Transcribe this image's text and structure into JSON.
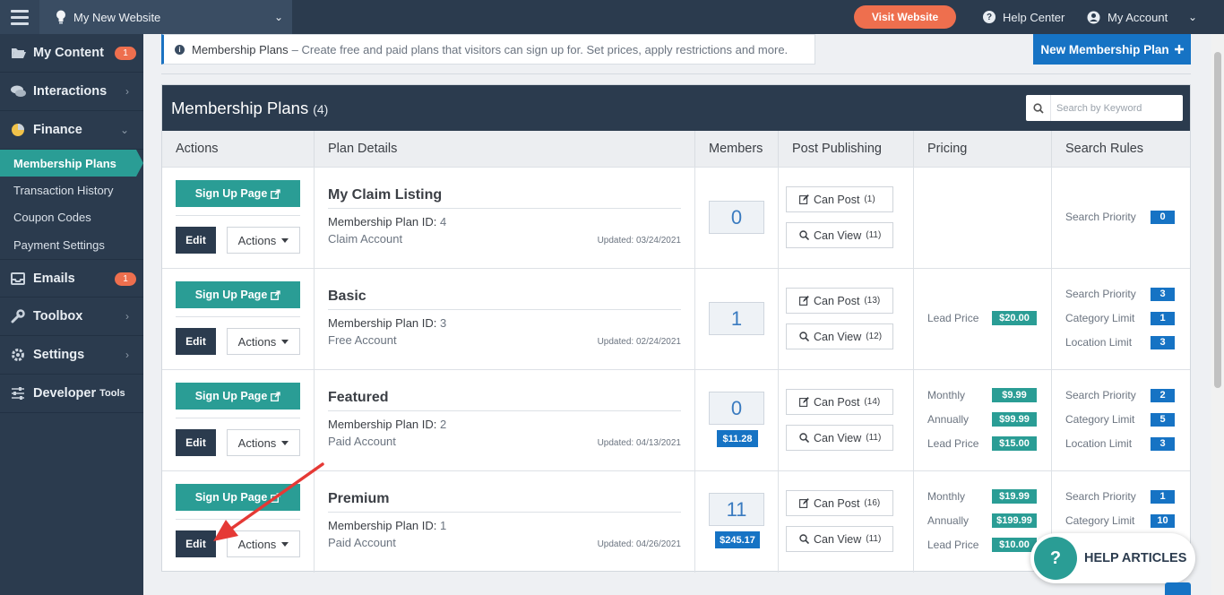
{
  "topbar": {
    "site_name": "My New Website",
    "visit_label": "Visit Website",
    "help_center_label": "Help Center",
    "my_account_label": "My Account"
  },
  "sidebar": {
    "items": [
      {
        "label": "My Content",
        "badge": "1"
      },
      {
        "label": "Interactions"
      },
      {
        "label": "Finance"
      },
      {
        "label": "Emails",
        "badge": "1"
      },
      {
        "label": "Toolbox"
      },
      {
        "label": "Settings"
      },
      {
        "label": "Developer",
        "suffix": "Tools"
      }
    ],
    "finance_sub": [
      "Membership Plans",
      "Transaction History",
      "Coupon Codes",
      "Payment Settings"
    ]
  },
  "info": {
    "title": "Membership Plans",
    "text": "– Create free and paid plans that visitors can sign up for. Set prices, apply restrictions and more."
  },
  "new_plan_label": "New Membership Plan",
  "panel": {
    "title": "Membership Plans",
    "count": "(4)",
    "search_placeholder": "Search by Keyword"
  },
  "columns": [
    "Actions",
    "Plan Details",
    "Members",
    "Post Publishing",
    "Pricing",
    "Search Rules"
  ],
  "buttons": {
    "signup": "Sign Up Page",
    "edit": "Edit",
    "actions": "Actions",
    "can_post": "Can Post",
    "can_view": "Can View"
  },
  "plans": [
    {
      "name": "My Claim Listing",
      "id_label": "Membership Plan ID:",
      "id": "4",
      "type": "Claim Account",
      "updated": "Updated: 03/24/2021",
      "members": "0",
      "revenue": "",
      "can_post": "(1)",
      "can_view": "(11)",
      "pricing": [],
      "rules": [
        {
          "label": "Search Priority",
          "value": "0"
        }
      ]
    },
    {
      "name": "Basic",
      "id_label": "Membership Plan ID:",
      "id": "3",
      "type": "Free Account",
      "updated": "Updated: 02/24/2021",
      "members": "1",
      "revenue": "",
      "can_post": "(13)",
      "can_view": "(12)",
      "pricing": [
        {
          "label": "Lead Price",
          "value": "$20.00"
        }
      ],
      "rules": [
        {
          "label": "Search Priority",
          "value": "3"
        },
        {
          "label": "Category Limit",
          "value": "1"
        },
        {
          "label": "Location Limit",
          "value": "3"
        }
      ]
    },
    {
      "name": "Featured",
      "id_label": "Membership Plan ID:",
      "id": "2",
      "type": "Paid Account",
      "updated": "Updated: 04/13/2021",
      "members": "0",
      "revenue": "$11.28",
      "can_post": "(14)",
      "can_view": "(11)",
      "pricing": [
        {
          "label": "Monthly",
          "value": "$9.99"
        },
        {
          "label": "Annually",
          "value": "$99.99"
        },
        {
          "label": "Lead Price",
          "value": "$15.00"
        }
      ],
      "rules": [
        {
          "label": "Search Priority",
          "value": "2"
        },
        {
          "label": "Category Limit",
          "value": "5"
        },
        {
          "label": "Location Limit",
          "value": "3"
        }
      ]
    },
    {
      "name": "Premium",
      "id_label": "Membership Plan ID:",
      "id": "1",
      "type": "Paid Account",
      "updated": "Updated: 04/26/2021",
      "members": "11",
      "revenue": "$245.17",
      "can_post": "(16)",
      "can_view": "(11)",
      "pricing": [
        {
          "label": "Monthly",
          "value": "$19.99"
        },
        {
          "label": "Annually",
          "value": "$199.99"
        },
        {
          "label": "Lead Price",
          "value": "$10.00"
        }
      ],
      "rules": [
        {
          "label": "Search Priority",
          "value": "1"
        },
        {
          "label": "Category Limit",
          "value": "10"
        }
      ]
    }
  ],
  "help_articles_label": "HELP ARTICLES",
  "colors": {
    "navy": "#2b3b4e",
    "teal": "#2a9d95",
    "blue": "#1673c4",
    "orange": "#ee6f4e",
    "annotation_red": "#e53935"
  }
}
